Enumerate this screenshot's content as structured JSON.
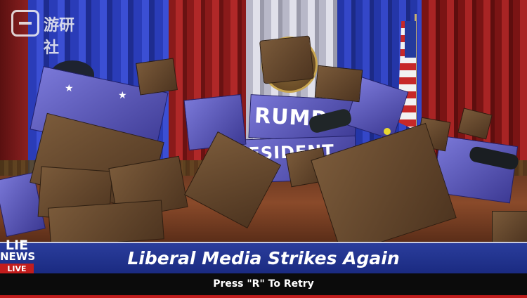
{
  "watermark": {
    "text": "游研社",
    "icon": "gamepad-icon"
  },
  "podium": {
    "line1": "RUMP",
    "line2": "RESIDENT"
  },
  "chyron": {
    "headline": "Liberal Media Strikes Again"
  },
  "brand": {
    "line1": "LIE",
    "line2": "NEWS",
    "badge": "LIVE"
  },
  "ticker": {
    "prompt": "Press \"R\" To Retry"
  },
  "colors": {
    "chyron": "#1a2a80",
    "live_badge": "#c21d1d",
    "podium": "#4a48b8",
    "crate": "#6a4a2e"
  }
}
